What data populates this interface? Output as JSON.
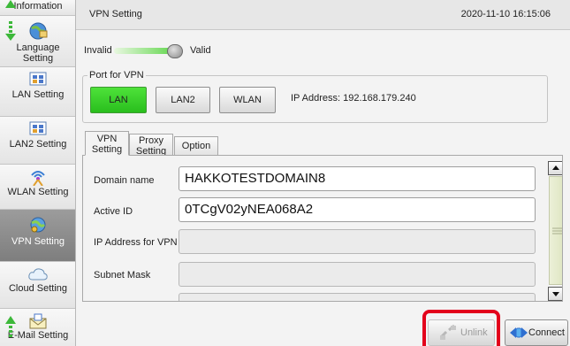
{
  "sidebar": {
    "items": [
      {
        "label": "Information"
      },
      {
        "label": "Language Setting"
      },
      {
        "label": "LAN Setting"
      },
      {
        "label": "LAN2 Setting"
      },
      {
        "label": "WLAN Setting"
      },
      {
        "label": "VPN Setting",
        "active": true
      },
      {
        "label": "Cloud Setting"
      },
      {
        "label": "E-Mail Setting"
      }
    ]
  },
  "header": {
    "title": "VPN Setting",
    "datetime": "2020-11-10 16:15:06"
  },
  "vpn_toggle": {
    "off_label": "Invalid",
    "on_label": "Valid",
    "state": "Valid"
  },
  "port": {
    "legend": "Port for VPN",
    "buttons": [
      {
        "label": "LAN",
        "selected": true
      },
      {
        "label": "LAN2",
        "selected": false
      },
      {
        "label": "WLAN",
        "selected": false
      }
    ],
    "ip_address": "IP Address: 192.168.179.240"
  },
  "tabs": [
    {
      "line1": "VPN",
      "line2": "Setting",
      "active": true
    },
    {
      "line1": "Proxy",
      "line2": "Setting",
      "active": false
    },
    {
      "line1": "Option",
      "line2": "",
      "active": false
    }
  ],
  "fields": [
    {
      "label": "Domain name",
      "value": "HAKKOTESTDOMAIN8"
    },
    {
      "label": "Active ID",
      "value": "0TCgV02yNEA068A2"
    },
    {
      "label": "IP Address for VPN",
      "value": ""
    },
    {
      "label": "Subnet Mask",
      "value": ""
    }
  ],
  "actions": {
    "unlink_label": "Unlink",
    "connect_label": "Connect"
  },
  "colors": {
    "selected_green": "#2fc624",
    "highlight_red": "#e3001b",
    "active_sidebar": "#8c8c8c"
  }
}
